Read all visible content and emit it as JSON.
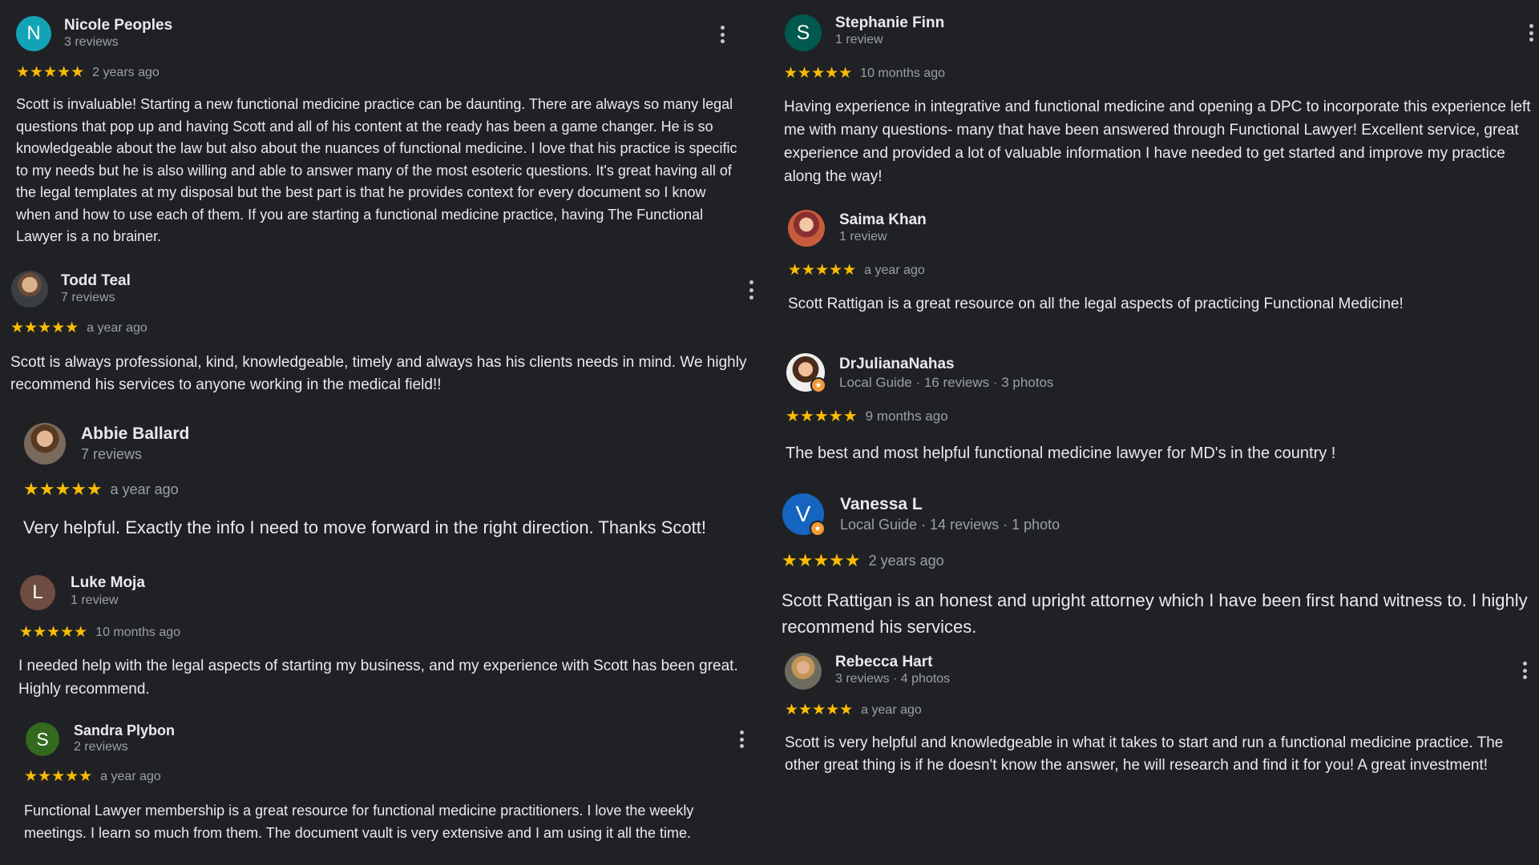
{
  "colors": {
    "background": "#202124",
    "star": "#fbbc04",
    "text": "#e8eaed",
    "meta": "#9aa0a6",
    "guide_badge": "#f29b38"
  },
  "reviews": [
    {
      "name": "Nicole Peoples",
      "meta": "3 reviews",
      "avatar_letter": "N",
      "avatar_color": "#12a4b6",
      "stars": "★★★★★",
      "time": "2 years ago",
      "text": "Scott is invaluable! Starting a new functional medicine practice can be daunting. There are always so many legal questions that pop up and having Scott and all of his content at the ready has been a game changer. He is so knowledgeable about the law but also about the nuances of functional medicine. I love that his practice is specific to my needs but he is also willing and able to answer many of the most esoteric questions. It's great having all of the legal templates at my disposal but the best part is that he provides context for every document so I know when and how to use each of them. If you are starting a functional medicine practice, having The Functional Lawyer is a no brainer."
    },
    {
      "name": "Todd Teal",
      "meta": "7 reviews",
      "avatar_icon": "person-photo-icon",
      "stars": "★★★★★",
      "time": "a year ago",
      "text": "Scott is always professional, kind, knowledgeable, timely and always has his clients needs in mind. We highly recommend his services to anyone working in the medical field!!"
    },
    {
      "name": "Abbie Ballard",
      "meta": "7 reviews",
      "avatar_icon": "person-photo-icon",
      "stars": "★★★★★",
      "time": "a year ago",
      "text": "Very helpful. Exactly the info I need to move forward in the right direction. Thanks Scott!"
    },
    {
      "name": "Luke Moja",
      "meta": "1 review",
      "avatar_letter": "L",
      "avatar_color": "#6d4c41",
      "stars": "★★★★★",
      "time": "10 months ago",
      "text": "I needed help with the legal aspects of starting my business, and my experience with Scott has been great. Highly recommend."
    },
    {
      "name": "Sandra Plybon",
      "meta": "2 reviews",
      "avatar_letter": "S",
      "avatar_color": "#33691e",
      "stars": "★★★★★",
      "time": "a year ago",
      "text": "Functional Lawyer membership is a great resource for functional medicine practitioners. I love the weekly meetings. I learn so much from them. The document vault is very extensive and I am using it all the time."
    },
    {
      "name": "Stephanie Finn",
      "meta": "1 review",
      "avatar_letter": "S",
      "avatar_color": "#00594f",
      "stars": "★★★★★",
      "time": "10 months ago",
      "text": "Having experience in integrative and functional medicine and opening a DPC to incorporate this experience left me with many questions- many that have been answered through Functional Lawyer! Excellent service, great experience and provided a lot of valuable information I have needed to get started and improve my practice along the way!"
    },
    {
      "name": "Saima Khan",
      "meta": "1 review",
      "avatar_icon": "person-photo-icon",
      "stars": "★★★★★",
      "time": "a year ago",
      "text": "Scott Rattigan is a great resource on all the legal aspects of practicing Functional Medicine!"
    },
    {
      "name": "DrJulianaNahas",
      "meta": "Local Guide · 16 reviews · 3 photos",
      "avatar_icon": "person-photo-icon",
      "stars": "★★★★★",
      "time": "9 months ago",
      "text": "The best and most helpful functional medicine lawyer for MD's in the country !"
    },
    {
      "name": "Vanessa L",
      "meta": "Local Guide · 14 reviews · 1 photo",
      "avatar_letter": "V",
      "avatar_color": "#1565c0",
      "stars": "★★★★★",
      "time": "2 years ago",
      "text": "Scott Rattigan is an honest and upright attorney which I have been first hand witness to. I highly recommend his services."
    },
    {
      "name": "Rebecca Hart",
      "meta": "3 reviews · 4 photos",
      "avatar_icon": "person-photo-icon",
      "stars": "★★★★★",
      "time": "a year ago",
      "text": "Scott is very helpful and knowledgeable in what it takes to start and run a functional medicine practice. The other great thing is if he doesn't know the answer, he will research and find it for you! A great investment!"
    }
  ]
}
